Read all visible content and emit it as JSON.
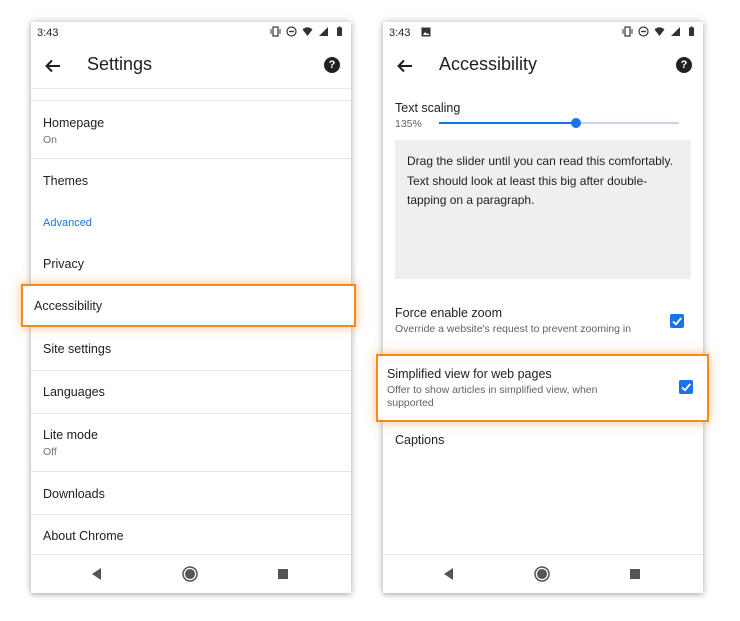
{
  "left": {
    "status": {
      "time": "3:43"
    },
    "appbar": {
      "title": "Settings"
    },
    "items": [
      {
        "label": "Homepage",
        "sub": "On"
      },
      {
        "label": "Themes"
      },
      {
        "section": "Advanced"
      },
      {
        "label": "Privacy"
      },
      {
        "label": "Accessibility"
      },
      {
        "label": "Site settings"
      },
      {
        "label": "Languages"
      },
      {
        "label": "Lite mode",
        "sub": "Off"
      },
      {
        "label": "Downloads"
      },
      {
        "label": "About Chrome"
      }
    ]
  },
  "right": {
    "status": {
      "time": "3:43"
    },
    "appbar": {
      "title": "Accessibility"
    },
    "text_scaling": {
      "label": "Text scaling",
      "value": "135%",
      "slider_fraction": 0.57
    },
    "preview_text": "Drag the slider until you can read this comfortably. Text should look at least this big after double-tapping on a paragraph.",
    "force_zoom": {
      "label": "Force enable zoom",
      "sub": "Override a website's request to prevent zooming in",
      "checked": true
    },
    "simplified": {
      "label": "Simplified view for web pages",
      "sub": "Offer to show articles in simplified view, when supported",
      "checked": true
    },
    "captions": {
      "label": "Captions"
    }
  },
  "colors": {
    "accent": "#1a73e8",
    "highlight": "#f28a1f"
  },
  "icons": {
    "back": "arrow-back-icon",
    "help": "help-icon",
    "nav_back": "triangle-back-icon",
    "nav_home": "circle-home-icon",
    "nav_recent": "square-recents-icon"
  }
}
